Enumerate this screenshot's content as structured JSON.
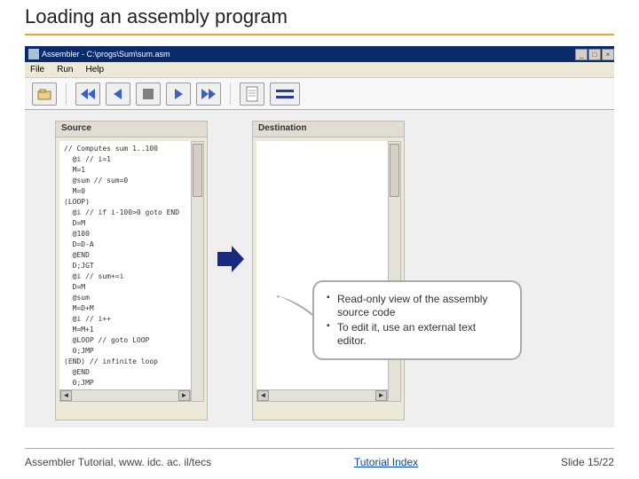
{
  "title": "Loading an assembly program",
  "window": {
    "title": "Assembler - C:\\progs\\Sum\\sum.asm",
    "menus": [
      "File",
      "Run",
      "Help"
    ],
    "toolbar_icons": [
      "open-icon",
      "fast-back-icon",
      "step-back-icon",
      "pause-icon",
      "step-fwd-icon",
      "fast-fwd-icon",
      "paper-icon",
      "equals-icon"
    ]
  },
  "panels": {
    "source_label": "Source",
    "dest_label": "Destination",
    "source_code": [
      "// Computes sum 1..100",
      "  @i // i=1",
      "  M=1",
      "  @sum // sum=0",
      "  M=0",
      "(LOOP)",
      "  @i // if i-100>0 goto END",
      "  D=M",
      "  @100",
      "  D=D-A",
      "  @END",
      "  D;JGT",
      "  @i // sum+=i",
      "  D=M",
      "  @sum",
      "  M=D+M",
      "  @i // i++",
      "  M=M+1",
      "  @LOOP // goto LOOP",
      "  0;JMP",
      "(END) // infinite loop",
      "  @END",
      "  0;JMP"
    ]
  },
  "callout": {
    "item1": "Read-only view of the assembly source code",
    "item2": "To edit it, use an external text editor."
  },
  "footer": {
    "left": "Assembler Tutorial, www. idc. ac. il/tecs",
    "center": "Tutorial Index",
    "right": "Slide 15/22"
  }
}
